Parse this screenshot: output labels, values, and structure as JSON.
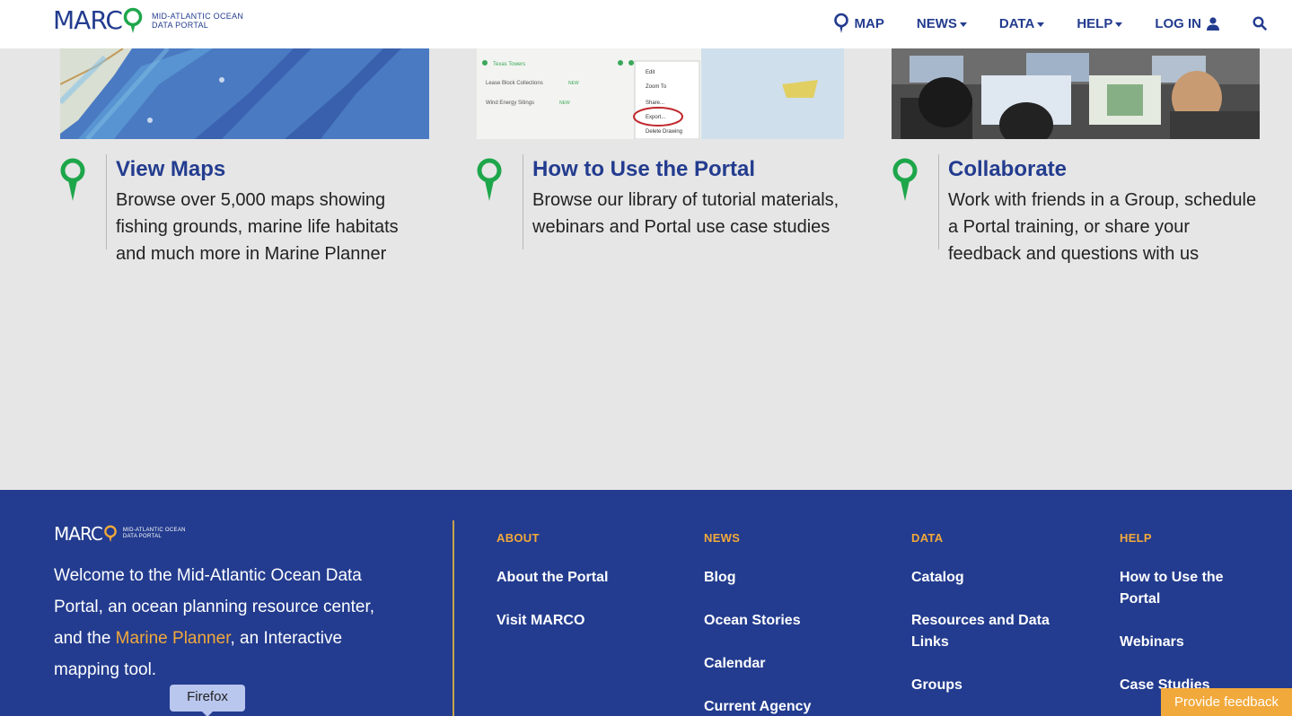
{
  "header": {
    "logo_word": "MARC",
    "logo_sub_line1": "Mid-Atlantic Ocean",
    "logo_sub_line2": "Data Portal",
    "nav": {
      "map": "MAP",
      "news": "NEWS",
      "data": "DATA",
      "help": "HELP",
      "login": "LOG IN"
    }
  },
  "cards": [
    {
      "title": "View Maps",
      "description": "Browse over 5,000 maps showing fishing grounds, marine life habitats and much more in Marine Planner"
    },
    {
      "title": "How to Use the Portal",
      "description": "Browse our library of tutorial materials, webinars and Portal use case studies"
    },
    {
      "title": "Collaborate",
      "description": "Work with friends in a Group, schedule a Portal training, or share your feedback and questions with us"
    }
  ],
  "screenshot_menu": {
    "list1": "Texas Towers",
    "list2": "Lease Block Collections",
    "list3": "Wind Energy Sitings",
    "new_badge": "NEW",
    "edit": "Edit",
    "zoom": "Zoom To",
    "share": "Share...",
    "export": "Export...",
    "delete": "Delete Drawing"
  },
  "footer": {
    "logo_word": "MARC",
    "logo_sub_line1": "Mid-Atlantic Ocean",
    "logo_sub_line2": "Data Portal",
    "welcome_before": "Welcome to the Mid-Atlantic Ocean Data Portal, an ocean planning resource center, and the ",
    "welcome_link": "Marine Planner",
    "welcome_after": ", an Interactive mapping tool.",
    "columns": {
      "about": {
        "heading": "ABOUT",
        "links": [
          "About the Portal",
          "Visit MARCO"
        ]
      },
      "news": {
        "heading": "NEWS",
        "links": [
          "Blog",
          "Ocean Stories",
          "Calendar",
          "Current Agency"
        ]
      },
      "data": {
        "heading": "DATA",
        "links": [
          "Catalog",
          "Resources and Data Links",
          "Groups"
        ]
      },
      "help": {
        "heading": "HELP",
        "links": [
          "How to Use the Portal",
          "Webinars",
          "Case Studies"
        ]
      }
    }
  },
  "tooltip": "Firefox",
  "feedback_button": "Provide feedback",
  "colors": {
    "brand_navy": "#233c8f",
    "accent_orange": "#f2a93b",
    "pin_green": "#1ea64b",
    "page_bg": "#e6e6e6"
  },
  "icons": [
    "map-pin-icon",
    "user-icon",
    "search-icon",
    "caret-down-icon"
  ]
}
